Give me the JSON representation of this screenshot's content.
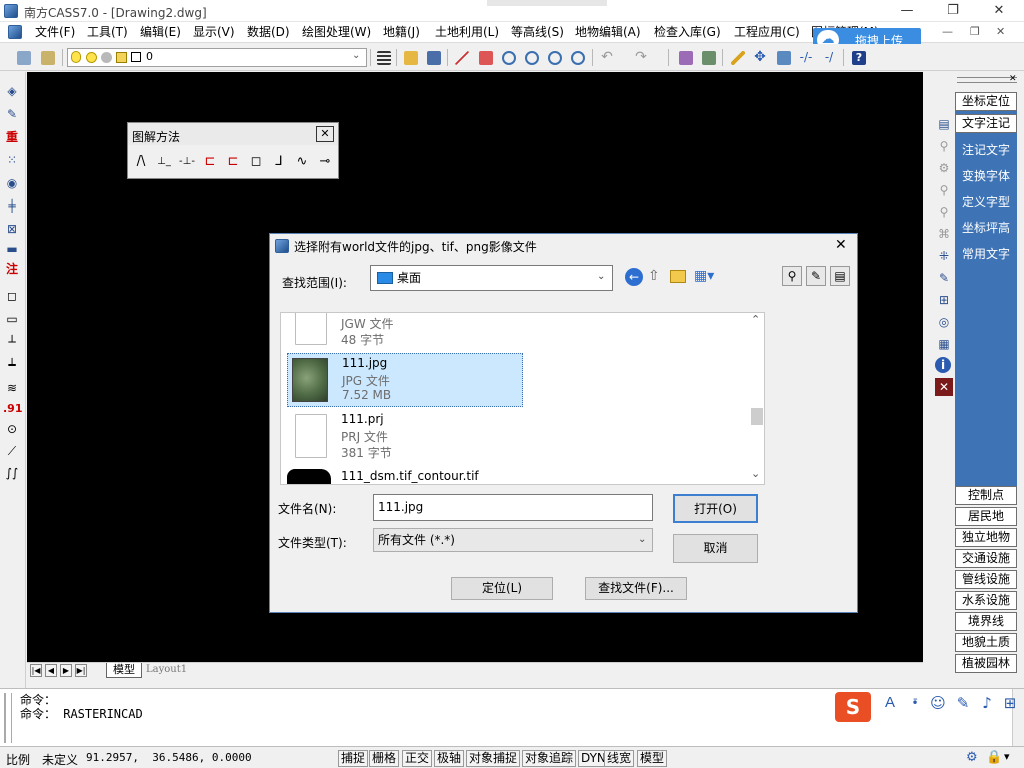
{
  "window": {
    "title": "南方CASS7.0 - [Drawing2.dwg]",
    "minimize": "—",
    "restore": "❐",
    "close": "✕"
  },
  "menu": [
    "文件(F)",
    "工具(T)",
    "编辑(E)",
    "显示(V)",
    "数据(D)",
    "绘图处理(W)",
    "地籍(J)",
    "土地利用(L)",
    "等高线(S)",
    "地物编辑(A)",
    "检查入库(G)",
    "工程应用(C)",
    "图幅管理(M)"
  ],
  "upload": {
    "label": "拖拽上传"
  },
  "mdi": {
    "minimize": "—",
    "restore": "❐",
    "close": "✕"
  },
  "toolbar": {
    "layer_value": "0"
  },
  "left_toolbar": {
    "zhong": "重",
    "zhu": "注",
    "num": ".91"
  },
  "right_panel": {
    "top_button": "坐标定位",
    "second_button": "文字注记",
    "links": [
      "注记文字",
      "变换字体",
      "定义字型",
      "坐标坪高",
      "常用文字"
    ],
    "bottom_buttons": [
      "控制点",
      "居民地",
      "独立地物",
      "交通设施",
      "管线设施",
      "水系设施",
      "境界线",
      "地貌土质",
      "植被园林"
    ]
  },
  "palette": {
    "title": "图解方法",
    "close": "✕"
  },
  "dialog": {
    "title": "选择附有world文件的jpg、tif、png影像文件",
    "close": "✕",
    "lookin_label": "查找范围(I):",
    "lookin_value": "桌面",
    "files": [
      {
        "name": "",
        "type": "JGW 文件",
        "size": "48 字节",
        "selected": false
      },
      {
        "name": "111.jpg",
        "type": "JPG 文件",
        "size": "7.52 MB",
        "selected": true
      },
      {
        "name": "111.prj",
        "type": "PRJ 文件",
        "size": "381 字节",
        "selected": false
      },
      {
        "name": "111_dsm.tif_contour.tif",
        "type": "",
        "size": "",
        "selected": false
      }
    ],
    "filename_label": "文件名(N):",
    "filename_value": "111.jpg",
    "filetype_label": "文件类型(T):",
    "filetype_value": "所有文件 (*.*)",
    "open_button": "打开(O)",
    "cancel_button": "取消",
    "locate_button": "定位(L)",
    "find_button": "查找文件(F)..."
  },
  "layout_tabs": {
    "model": "模型",
    "layout1": "Layout1"
  },
  "command": {
    "line1": "命令：",
    "line2": "命令： RASTERINCAD"
  },
  "status": {
    "scale_label": "比例",
    "scale_value": "未定义",
    "coords": "91.2957,  36.5486, 0.0000",
    "buttons": [
      "捕捉",
      "栅格",
      "正交",
      "极轴",
      "对象捕捉",
      "对象追踪",
      "DYN",
      "线宽",
      "模型"
    ]
  },
  "colors": {
    "canvas": "#000000",
    "panel_blue": "#3e74b6",
    "selection": "#cce8ff",
    "dialog_border": "#5a84b8"
  }
}
